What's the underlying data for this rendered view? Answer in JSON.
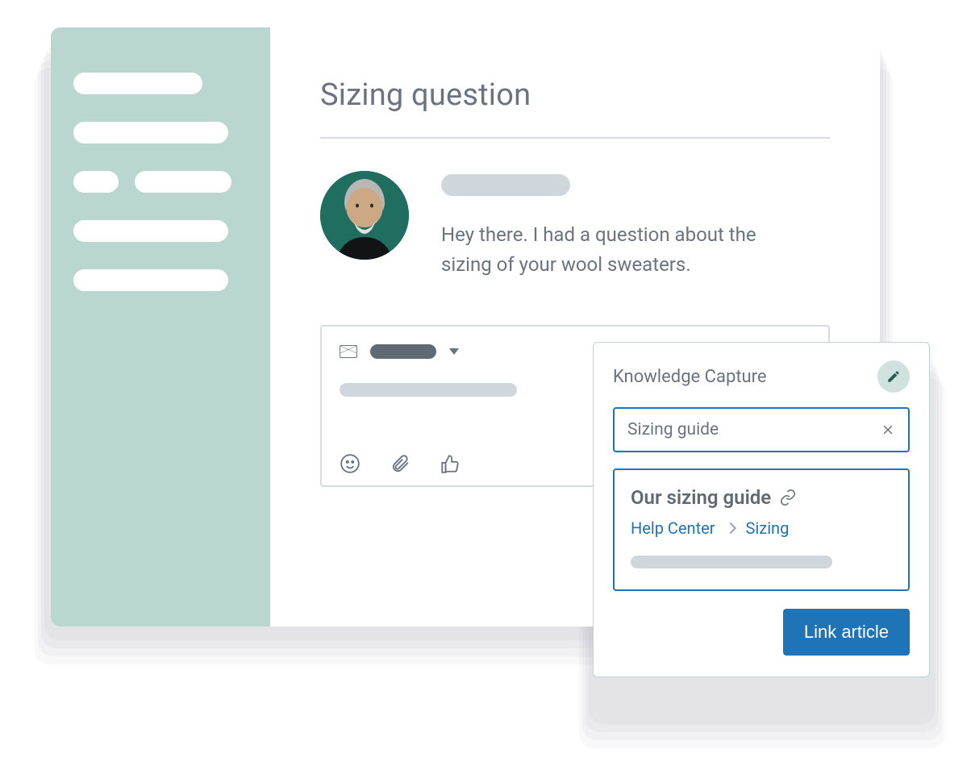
{
  "ticket": {
    "title": "Sizing question",
    "message": "Hey there. I had a question about the sizing of your wool sweaters."
  },
  "knowledge_capture": {
    "panel_title": "Knowledge Capture",
    "search_value": "Sizing guide",
    "result": {
      "title": "Our sizing guide",
      "breadcrumbs": [
        "Help Center",
        "Sizing"
      ]
    },
    "link_button": "Link article"
  }
}
